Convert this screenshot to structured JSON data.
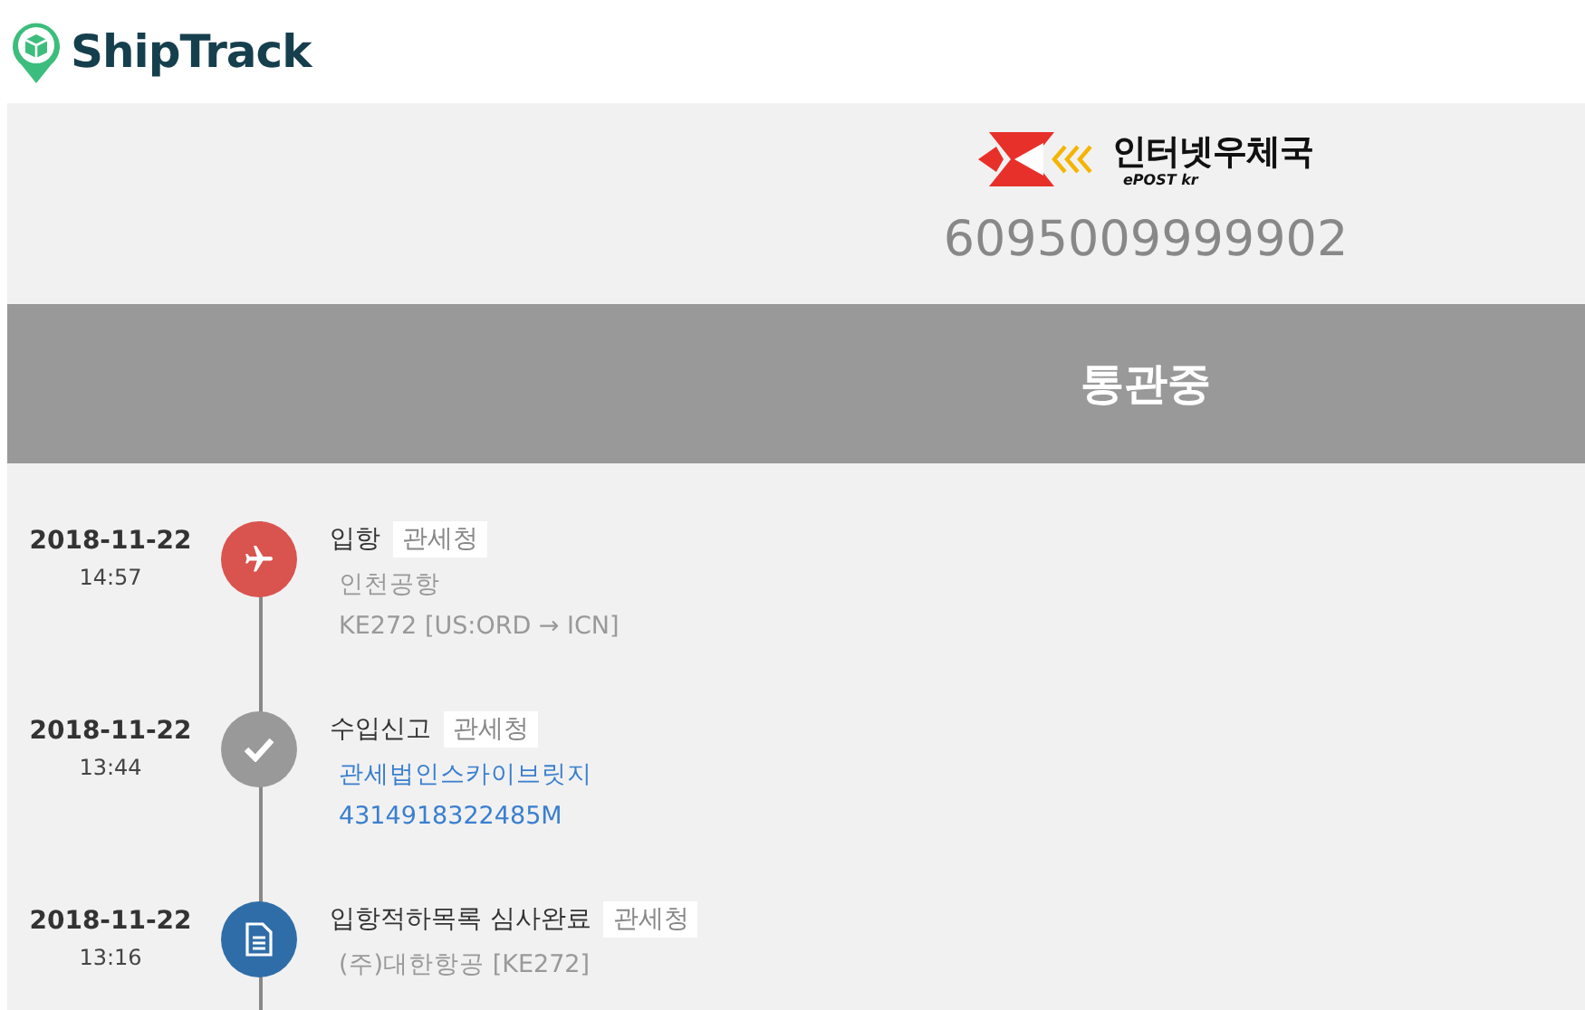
{
  "app": {
    "name": "ShipTrack"
  },
  "carrier": {
    "name": "인터넷우체국",
    "subtitle": "ePOST kr",
    "tracking_number": "6095009999902"
  },
  "status": "통관중",
  "events": [
    {
      "date": "2018-11-22",
      "time": "14:57",
      "kind": "plane",
      "title": "입항",
      "tag": "관세청",
      "details": [
        {
          "text": "인천공항",
          "link": false
        },
        {
          "text": "KE272 [US:ORD → ICN]",
          "link": false
        }
      ]
    },
    {
      "date": "2018-11-22",
      "time": "13:44",
      "kind": "check",
      "title": "수입신고",
      "tag": "관세청",
      "details": [
        {
          "text": "관세법인스카이브릿지",
          "link": true
        },
        {
          "text": "4314918322485M",
          "link": true
        }
      ]
    },
    {
      "date": "2018-11-22",
      "time": "13:16",
      "kind": "document",
      "title": "입항적하목록 심사완료",
      "tag": "관세청",
      "details": [
        {
          "text": "(주)대한항공 [KE272]",
          "link": false
        }
      ]
    }
  ]
}
